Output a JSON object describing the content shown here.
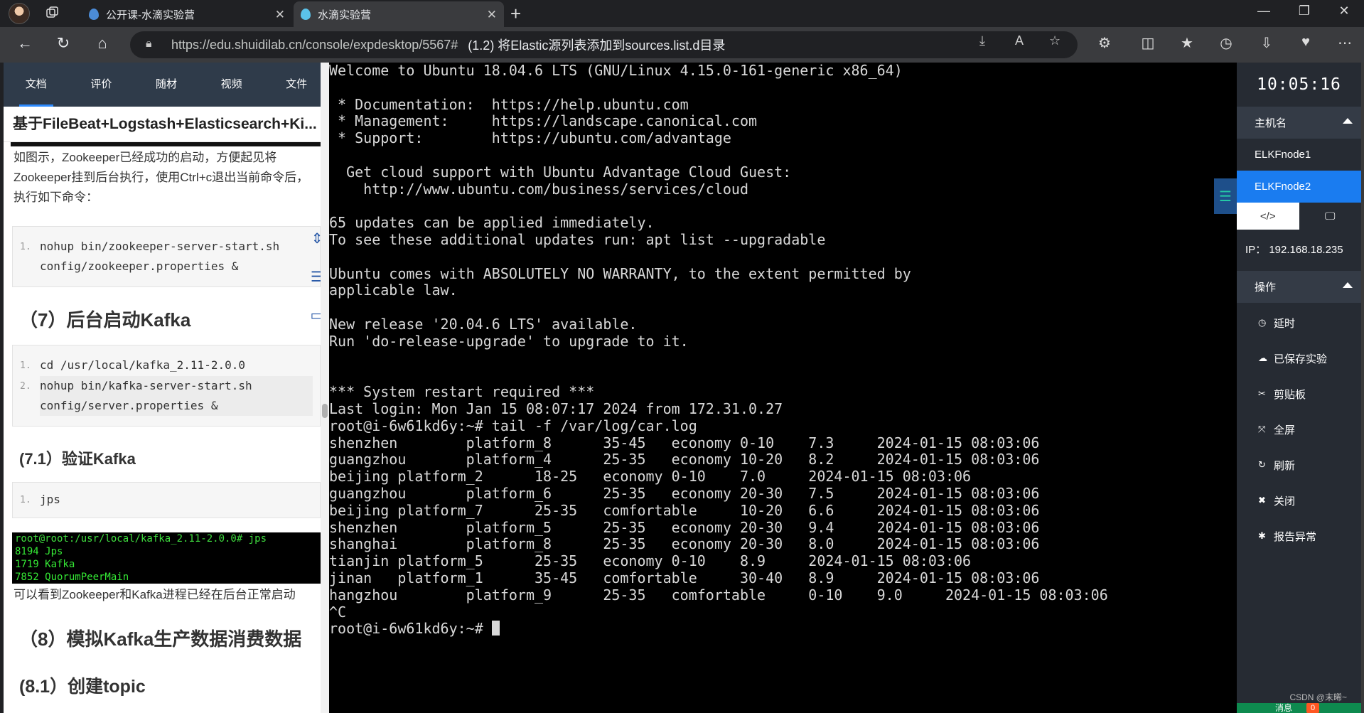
{
  "browser": {
    "tabs": [
      {
        "title": "公开课-水滴实验营"
      },
      {
        "title": "水滴实验营"
      }
    ],
    "url_host": "https://edu.shuidilab.cn/console/expdesktop/5567#",
    "url_rest": "(1.2) 将Elastic源列表添加到sources.list.d目录"
  },
  "doc": {
    "tabs": [
      "文档",
      "评价",
      "随材",
      "视频",
      "文件"
    ],
    "title": "基于FileBeat+Logstash+Elasticsearch+Ki...",
    "para1": "如图示，Zookeeper已经成功的启动，方便起见将Zookeeper挂到后台执行，使用Ctrl+c退出当前命令后，执行如下命令：",
    "code1": [
      {
        "n": "1.",
        "text": "nohup bin/zookeeper-server-start.sh config/zookeeper.properties &"
      }
    ],
    "h_start_kafka": "（7）后台启动Kafka",
    "code2": [
      {
        "n": "1.",
        "text": "cd /usr/local/kafka_2.11-2.0.0"
      },
      {
        "n": "2.",
        "text": "nohup bin/kafka-server-start.sh config/server.properties &"
      }
    ],
    "h_verify": "(7.1）验证Kafka",
    "code3": [
      {
        "n": "1.",
        "text": "jps"
      }
    ],
    "shot_lines": [
      "root@root:/usr/local/kafka_2.11-2.0.0# jps",
      "8194 Jps",
      "1719 Kafka",
      "7852 QuorumPeerMain"
    ],
    "para2": "可以看到Zookeeper和Kafka进程已经在后台正常启动",
    "h_simulate": "（8）模拟Kafka生产数据消费数据",
    "h_topic": "(8.1）创建topic"
  },
  "terminal": {
    "lines": [
      "Welcome to Ubuntu 18.04.6 LTS (GNU/Linux 4.15.0-161-generic x86_64)",
      "",
      " * Documentation:  https://help.ubuntu.com",
      " * Management:     https://landscape.canonical.com",
      " * Support:        https://ubuntu.com/advantage",
      "",
      "  Get cloud support with Ubuntu Advantage Cloud Guest:",
      "    http://www.ubuntu.com/business/services/cloud",
      "",
      "65 updates can be applied immediately.",
      "To see these additional updates run: apt list --upgradable",
      "",
      "Ubuntu comes with ABSOLUTELY NO WARRANTY, to the extent permitted by",
      "applicable law.",
      "",
      "New release '20.04.6 LTS' available.",
      "Run 'do-release-upgrade' to upgrade to it.",
      "",
      "",
      "*** System restart required ***",
      "Last login: Mon Jan 15 08:07:17 2024 from 172.31.0.27",
      "root@i-6w61kd6y:~# tail -f /var/log/car.log",
      "shenzhen        platform_8      35-45   economy 0-10    7.3     2024-01-15 08:03:06",
      "guangzhou       platform_4      25-35   economy 10-20   8.2     2024-01-15 08:03:06",
      "beijing platform_2      18-25   economy 0-10    7.0     2024-01-15 08:03:06",
      "guangzhou       platform_6      25-35   economy 20-30   7.5     2024-01-15 08:03:06",
      "beijing platform_7      25-35   comfortable     10-20   6.6     2024-01-15 08:03:06",
      "shenzhen        platform_5      25-35   economy 20-30   9.4     2024-01-15 08:03:06",
      "shanghai        platform_8      25-35   economy 20-30   8.0     2024-01-15 08:03:06",
      "tianjin platform_5      25-35   economy 0-10    8.9     2024-01-15 08:03:06",
      "jinan   platform_1      35-45   comfortable     30-40   8.9     2024-01-15 08:03:06",
      "hangzhou        platform_9      25-35   comfortable     0-10    9.0     2024-01-15 08:03:06",
      "^C"
    ],
    "prompt": "root@i-6w61kd6y:~# "
  },
  "panel": {
    "time": "10:05:16",
    "host_header": "主机名",
    "hosts": [
      "ELKFnode1",
      "ELKFnode2"
    ],
    "ip": "IP：  192.168.18.235",
    "ops_header": "操作",
    "ops": [
      {
        "icon": "clock-icon",
        "label": "延时"
      },
      {
        "icon": "cloud-icon",
        "label": "已保存实验"
      },
      {
        "icon": "scissors-icon",
        "label": "剪贴板"
      },
      {
        "icon": "fullscreen-icon",
        "label": "全屏"
      },
      {
        "icon": "refresh-icon",
        "label": "刷新"
      },
      {
        "icon": "close-icon",
        "label": "关闭"
      },
      {
        "icon": "bug-icon",
        "label": "报告异常"
      }
    ],
    "footer_msg": "消息",
    "footer_badge": "0",
    "watermark": "CSDN @末晞~"
  },
  "colors": {
    "accent": "#1a7cf0",
    "doc_header": "#2f3b4a",
    "panel_bg": "#262b33",
    "terminal_bg": "#000000"
  }
}
